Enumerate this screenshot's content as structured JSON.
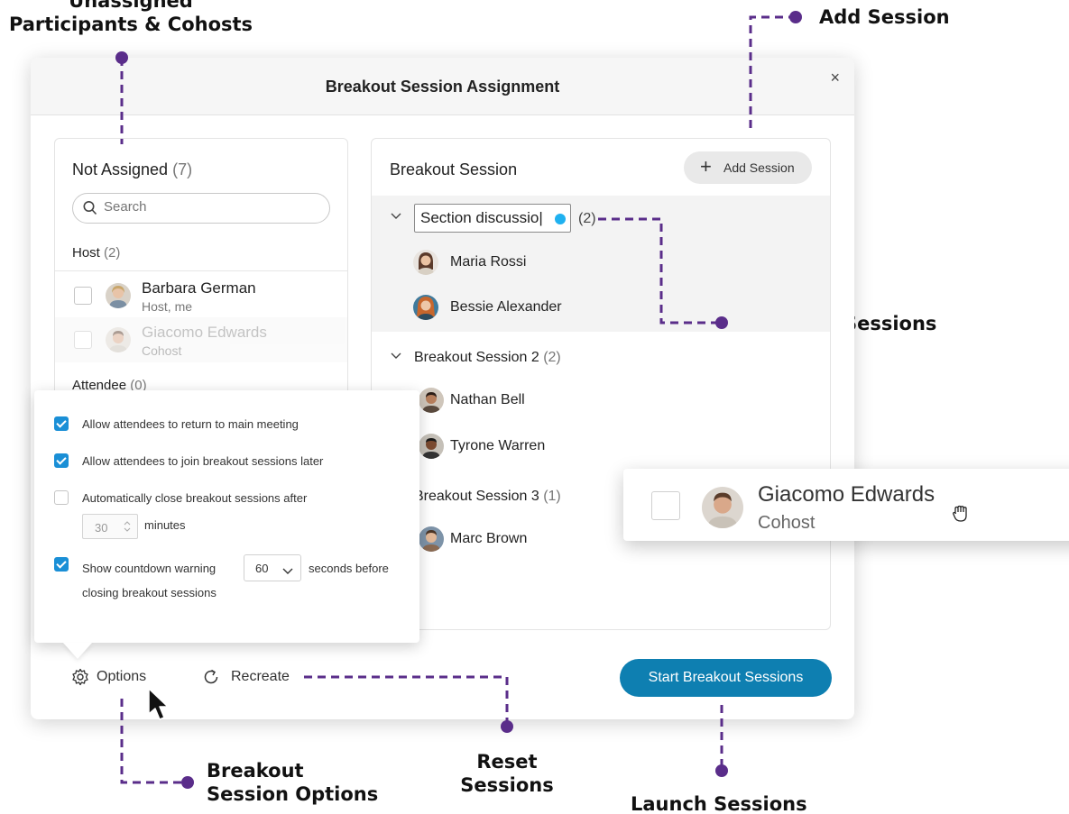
{
  "dialog": {
    "title": "Breakout Session Assignment",
    "close_label": "×"
  },
  "not_assigned": {
    "title": "Not Assigned",
    "count": "(7)",
    "search_placeholder": "Search",
    "host_group": {
      "label": "Host",
      "count": "(2)"
    },
    "attendee_group": {
      "label": "Attendee",
      "count": "(0)"
    },
    "people": [
      {
        "name": "Barbara German",
        "role": "Host, me"
      },
      {
        "name": "Giacomo Edwards",
        "role": "Cohost"
      }
    ]
  },
  "breakout": {
    "title": "Breakout Session",
    "add_session_label": "Add Session",
    "sessions": [
      {
        "name": "Section discussio|",
        "count": "(2)",
        "members": [
          "Maria Rossi",
          "Bessie Alexander"
        ]
      },
      {
        "name": "Breakout Session 2",
        "count": "(2)",
        "members": [
          "Nathan Bell",
          "Tyrone Warren"
        ]
      },
      {
        "name": "Breakout Session 3",
        "count": "(1)",
        "members": [
          "Marc Brown"
        ]
      }
    ]
  },
  "options": {
    "items": [
      {
        "label": "Allow attendees to return to main meeting",
        "checked": true
      },
      {
        "label": "Allow attendees to join breakout sessions later",
        "checked": true
      },
      {
        "label": "Automatically close breakout sessions after",
        "checked": false
      },
      {
        "label": "Show countdown warning",
        "checked": true
      }
    ],
    "close_minutes": "30",
    "minutes_label": "minutes",
    "countdown_seconds": "60",
    "seconds_label": "seconds before",
    "seconds_label_2": "closing breakout sessions"
  },
  "footer": {
    "options_label": "Options",
    "recreate_label": "Recreate",
    "start_label": "Start Breakout Sessions"
  },
  "drag_card": {
    "name": "Giacomo Edwards",
    "role": "Cohost"
  },
  "callouts": {
    "unassigned_1": "Unassigned",
    "unassigned_2": "Participants & Cohosts",
    "add_session": "Add Session",
    "rename_sessions": "Rename Sessions",
    "options_1": "Breakout",
    "options_2": "Session Options",
    "reset_1": "Reset",
    "reset_2": "Sessions",
    "launch": "Launch Sessions"
  },
  "colors": {
    "callout_purple": "#5a2d8a",
    "primary_button": "#0e7fb1",
    "checkbox_blue": "#1a8fd6",
    "cursor_dot": "#1fb1f0"
  }
}
